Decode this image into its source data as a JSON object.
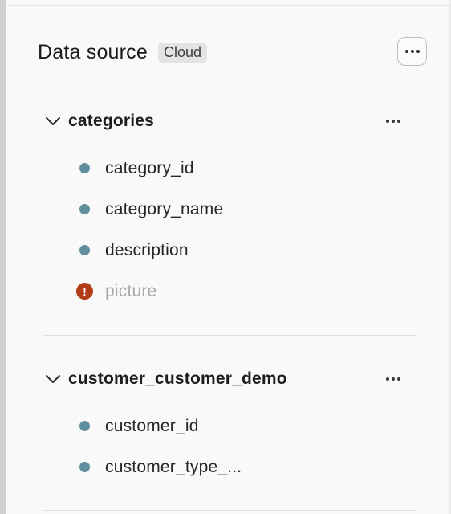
{
  "panel": {
    "title": "Data source",
    "badge": "Cloud"
  },
  "tables": [
    {
      "name": "categories",
      "expanded": true,
      "columns": [
        {
          "name": "category_id",
          "status": "ok"
        },
        {
          "name": "category_name",
          "status": "ok"
        },
        {
          "name": "description",
          "status": "ok"
        },
        {
          "name": "picture",
          "status": "error"
        }
      ]
    },
    {
      "name": "customer_customer_demo",
      "expanded": true,
      "columns": [
        {
          "name": "customer_id",
          "status": "ok"
        },
        {
          "name": "customer_type_...",
          "status": "ok"
        }
      ]
    }
  ],
  "icons": {
    "error_glyph": "!",
    "more": "more-horizontal-icon",
    "chevron": "chevron-down-icon"
  },
  "colors": {
    "column_dot": "#5f8f9c",
    "error": "#b23c17",
    "muted_text": "#a9a9a9"
  }
}
